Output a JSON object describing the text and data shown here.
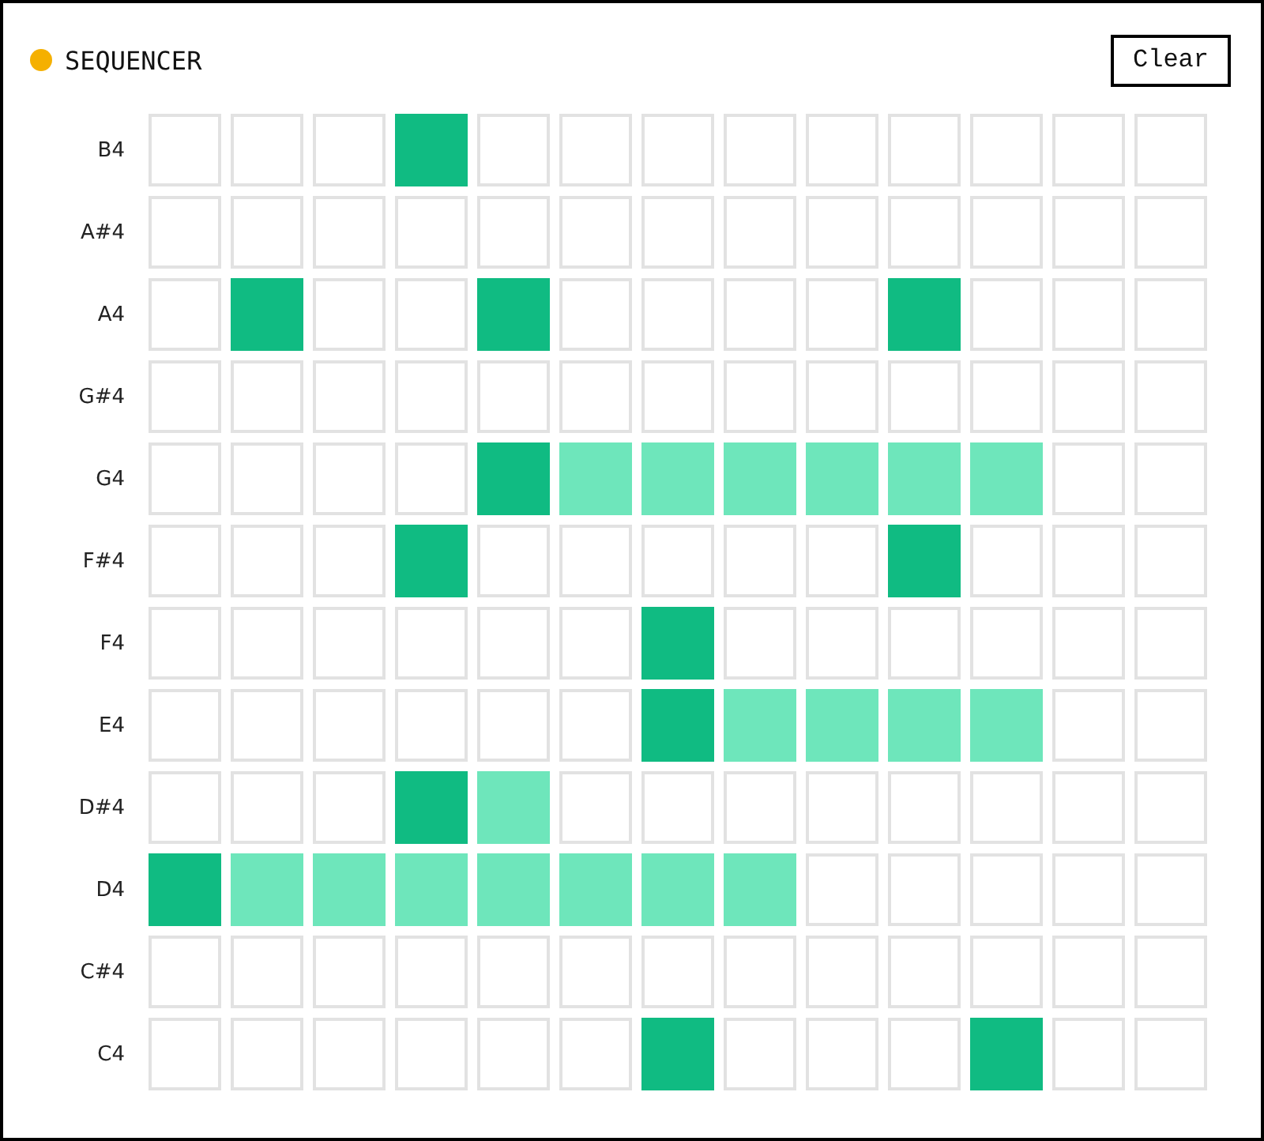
{
  "header": {
    "status_dot": {
      "color": "#f5b000"
    },
    "title": "SEQUENCER",
    "clear_button": "Clear"
  },
  "rows": [
    {
      "note": "B4",
      "cells": [
        {
          "start": false,
          "held": false
        },
        {
          "start": false,
          "held": false
        },
        {
          "start": false,
          "held": false
        },
        {
          "start": true,
          "held": false
        },
        {
          "start": false,
          "held": false
        },
        {
          "start": false,
          "held": false
        },
        {
          "start": false,
          "held": false
        },
        {
          "start": false,
          "held": false
        },
        {
          "start": false,
          "held": false
        },
        {
          "start": false,
          "held": false
        },
        {
          "start": false,
          "held": false
        },
        {
          "start": false,
          "held": false
        },
        {
          "start": false,
          "held": false
        }
      ]
    },
    {
      "note": "A#4",
      "cells": [
        {
          "start": false,
          "held": false
        },
        {
          "start": false,
          "held": false
        },
        {
          "start": false,
          "held": false
        },
        {
          "start": false,
          "held": false
        },
        {
          "start": false,
          "held": false
        },
        {
          "start": false,
          "held": false
        },
        {
          "start": false,
          "held": false
        },
        {
          "start": false,
          "held": false
        },
        {
          "start": false,
          "held": false
        },
        {
          "start": false,
          "held": false
        },
        {
          "start": false,
          "held": false
        },
        {
          "start": false,
          "held": false
        },
        {
          "start": false,
          "held": false
        }
      ]
    },
    {
      "note": "A4",
      "cells": [
        {
          "start": false,
          "held": false
        },
        {
          "start": true,
          "held": false
        },
        {
          "start": false,
          "held": false
        },
        {
          "start": false,
          "held": false
        },
        {
          "start": true,
          "held": false
        },
        {
          "start": false,
          "held": false
        },
        {
          "start": false,
          "held": false
        },
        {
          "start": false,
          "held": false
        },
        {
          "start": false,
          "held": false
        },
        {
          "start": true,
          "held": false
        },
        {
          "start": false,
          "held": false
        },
        {
          "start": false,
          "held": false
        },
        {
          "start": false,
          "held": false
        }
      ]
    },
    {
      "note": "G#4",
      "cells": [
        {
          "start": false,
          "held": false
        },
        {
          "start": false,
          "held": false
        },
        {
          "start": false,
          "held": false
        },
        {
          "start": false,
          "held": false
        },
        {
          "start": false,
          "held": false
        },
        {
          "start": false,
          "held": false
        },
        {
          "start": false,
          "held": false
        },
        {
          "start": false,
          "held": false
        },
        {
          "start": false,
          "held": false
        },
        {
          "start": false,
          "held": false
        },
        {
          "start": false,
          "held": false
        },
        {
          "start": false,
          "held": false
        },
        {
          "start": false,
          "held": false
        }
      ]
    },
    {
      "note": "G4",
      "cells": [
        {
          "start": false,
          "held": false
        },
        {
          "start": false,
          "held": false
        },
        {
          "start": false,
          "held": false
        },
        {
          "start": false,
          "held": false
        },
        {
          "start": true,
          "held": false
        },
        {
          "start": false,
          "held": true
        },
        {
          "start": false,
          "held": true
        },
        {
          "start": false,
          "held": true
        },
        {
          "start": false,
          "held": true
        },
        {
          "start": false,
          "held": true
        },
        {
          "start": false,
          "held": true
        },
        {
          "start": false,
          "held": false
        },
        {
          "start": false,
          "held": false
        }
      ]
    },
    {
      "note": "F#4",
      "cells": [
        {
          "start": false,
          "held": false
        },
        {
          "start": false,
          "held": false
        },
        {
          "start": false,
          "held": false
        },
        {
          "start": true,
          "held": false
        },
        {
          "start": false,
          "held": false
        },
        {
          "start": false,
          "held": false
        },
        {
          "start": false,
          "held": false
        },
        {
          "start": false,
          "held": false
        },
        {
          "start": false,
          "held": false
        },
        {
          "start": true,
          "held": false
        },
        {
          "start": false,
          "held": false
        },
        {
          "start": false,
          "held": false
        },
        {
          "start": false,
          "held": false
        }
      ]
    },
    {
      "note": "F4",
      "cells": [
        {
          "start": false,
          "held": false
        },
        {
          "start": false,
          "held": false
        },
        {
          "start": false,
          "held": false
        },
        {
          "start": false,
          "held": false
        },
        {
          "start": false,
          "held": false
        },
        {
          "start": false,
          "held": false
        },
        {
          "start": true,
          "held": false
        },
        {
          "start": false,
          "held": false
        },
        {
          "start": false,
          "held": false
        },
        {
          "start": false,
          "held": false
        },
        {
          "start": false,
          "held": false
        },
        {
          "start": false,
          "held": false
        },
        {
          "start": false,
          "held": false
        }
      ]
    },
    {
      "note": "E4",
      "cells": [
        {
          "start": false,
          "held": false
        },
        {
          "start": false,
          "held": false
        },
        {
          "start": false,
          "held": false
        },
        {
          "start": false,
          "held": false
        },
        {
          "start": false,
          "held": false
        },
        {
          "start": false,
          "held": false
        },
        {
          "start": true,
          "held": false
        },
        {
          "start": false,
          "held": true
        },
        {
          "start": false,
          "held": true
        },
        {
          "start": false,
          "held": true
        },
        {
          "start": false,
          "held": true
        },
        {
          "start": false,
          "held": false
        },
        {
          "start": false,
          "held": false
        }
      ]
    },
    {
      "note": "D#4",
      "cells": [
        {
          "start": false,
          "held": false
        },
        {
          "start": false,
          "held": false
        },
        {
          "start": false,
          "held": false
        },
        {
          "start": true,
          "held": false
        },
        {
          "start": false,
          "held": true
        },
        {
          "start": false,
          "held": false
        },
        {
          "start": false,
          "held": false
        },
        {
          "start": false,
          "held": false
        },
        {
          "start": false,
          "held": false
        },
        {
          "start": false,
          "held": false
        },
        {
          "start": false,
          "held": false
        },
        {
          "start": false,
          "held": false
        },
        {
          "start": false,
          "held": false
        }
      ]
    },
    {
      "note": "D4",
      "cells": [
        {
          "start": true,
          "held": false
        },
        {
          "start": false,
          "held": true
        },
        {
          "start": false,
          "held": true
        },
        {
          "start": false,
          "held": true
        },
        {
          "start": false,
          "held": true
        },
        {
          "start": false,
          "held": true
        },
        {
          "start": false,
          "held": true
        },
        {
          "start": false,
          "held": true
        },
        {
          "start": false,
          "held": false
        },
        {
          "start": false,
          "held": false
        },
        {
          "start": false,
          "held": false
        },
        {
          "start": false,
          "held": false
        },
        {
          "start": false,
          "held": false
        }
      ]
    },
    {
      "note": "C#4",
      "cells": [
        {
          "start": false,
          "held": false
        },
        {
          "start": false,
          "held": false
        },
        {
          "start": false,
          "held": false
        },
        {
          "start": false,
          "held": false
        },
        {
          "start": false,
          "held": false
        },
        {
          "start": false,
          "held": false
        },
        {
          "start": false,
          "held": false
        },
        {
          "start": false,
          "held": false
        },
        {
          "start": false,
          "held": false
        },
        {
          "start": false,
          "held": false
        },
        {
          "start": false,
          "held": false
        },
        {
          "start": false,
          "held": false
        },
        {
          "start": false,
          "held": false
        }
      ]
    },
    {
      "note": "C4",
      "cells": [
        {
          "start": false,
          "held": false
        },
        {
          "start": false,
          "held": false
        },
        {
          "start": false,
          "held": false
        },
        {
          "start": false,
          "held": false
        },
        {
          "start": false,
          "held": false
        },
        {
          "start": false,
          "held": false
        },
        {
          "start": true,
          "held": false
        },
        {
          "start": false,
          "held": false
        },
        {
          "start": false,
          "held": false
        },
        {
          "start": false,
          "held": false
        },
        {
          "start": true,
          "held": false
        },
        {
          "start": false,
          "held": false
        },
        {
          "start": false,
          "held": false
        }
      ]
    }
  ]
}
